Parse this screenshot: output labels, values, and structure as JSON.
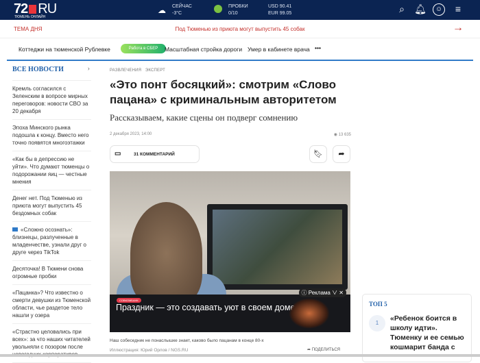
{
  "header": {
    "logo_num": "72",
    "logo_ru": "RU",
    "logo_sub": "ТЮМЕНЬ ОНЛАЙН",
    "weather_label": "СЕЙЧАС",
    "weather_value": "-3°C",
    "traffic_label": "ПРОБКИ",
    "traffic_value": "0/10",
    "usd": "USD 90.41",
    "eur": "EUR 99.05"
  },
  "topic": {
    "label": "ТЕМА ДНЯ",
    "headline": "Под Тюменью из приюта могут выпустить 45 собак"
  },
  "nav": {
    "items": [
      "Коттеджи на тюменской Рублевке",
      "Масштабная стройка дороги",
      "Умер в кабинете врача"
    ],
    "sber": "Работа в СБЕР",
    "more": "•••"
  },
  "sidebar": {
    "title": "ВСЕ НОВОСТИ",
    "items": [
      "Кремль согласился с Зеленским в вопросе мирных переговоров: новости СВО за 20 декабря",
      "Эпоха Минского рынка подошла к концу. Вместо него точно появятся многоэтажки",
      "«Как бы в депрессию не уйти». Что думают тюменцы о подорожании яиц — честные мнения",
      "Денег нет. Под Тюменью из приюта могут выпустить 45 бездомных собак",
      "«Сложно осознать»: близнецы, разлученные в младенчестве, узнали друг о друге через TikTok",
      "Десяточка! В Тюмени снова огромные пробки",
      "«Пацанка»? Что известно о смерти девушки из Тюменской области, чье раздетое тело нашли у озера",
      "«Страстно целовались при всех»: за что наших читателей увольняли с позором после новогодних корпоративов"
    ]
  },
  "article": {
    "cat1": "РАЗВЛЕЧЕНИЯ",
    "cat2": "ЭКСПЕРТ",
    "title": "«Это понт босяцкий»: смотрим «Слово пацана» с криминальным авторитетом",
    "lead": "Рассказываем, какие сцены он подверг сомнению",
    "date": "2 декабря 2023, 14:00",
    "views": "13 635",
    "comments": "31 КОММЕНТАРИЙ",
    "caption": "Наш собеседник не понаслышке знает, каково было пацанам в конце 80-х",
    "credit": "Иллюстрация: Юрий Орлов / NGS.RU",
    "share": "ПОДЕЛИТЬСЯ"
  },
  "ad": {
    "badge": "СОВКОМБАНК",
    "text": "Праздник — это создавать уют в своем доме",
    "label": "Реклама"
  },
  "top5": {
    "title": "ТОП 5",
    "num": "1",
    "item": "«Ребенок боится в школу идти». Тюменку и ее семью кошмарит банда с"
  }
}
